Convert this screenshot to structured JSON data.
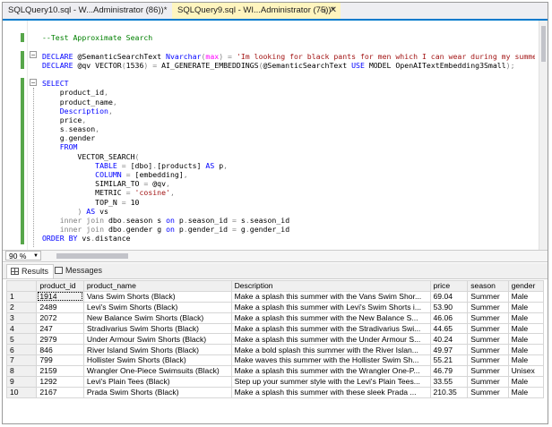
{
  "tabs": [
    {
      "title": "SQLQuery10.sql - W...Administrator (86))*",
      "active": false
    },
    {
      "title": "SQLQuery9.sql - WI...Administrator (75))*",
      "active": true,
      "pin": "⊣",
      "close": "✕"
    }
  ],
  "editor": {
    "zoom": "90 %",
    "lines": [
      [],
      [
        [
          "cm",
          "--Test Approximate Search"
        ]
      ],
      [],
      [
        [
          "kw",
          "DECLARE "
        ],
        [
          "id",
          "@SemanticSearchText "
        ],
        [
          "kw",
          "Nvarchar"
        ],
        [
          "gr",
          "("
        ],
        [
          "fn",
          "max"
        ],
        [
          "gr",
          ") = "
        ],
        [
          "str",
          "'Im looking for black pants for men which I can wear during my summer vacation.'"
        ]
      ],
      [
        [
          "kw",
          "DECLARE "
        ],
        [
          "id",
          "@qv "
        ],
        [
          "sq",
          "VECTOR"
        ],
        [
          "gr",
          "("
        ],
        [
          "id",
          "1536"
        ],
        [
          "gr",
          ") = "
        ],
        [
          "sq",
          "AI_GENERATE_EMBEDDINGS"
        ],
        [
          "gr",
          "("
        ],
        [
          "sq",
          "@SemanticSearchText"
        ],
        [
          "id",
          " "
        ],
        [
          "kw",
          "USE "
        ],
        [
          "id",
          "MODEL "
        ],
        [
          "sq",
          "OpenAITextEmbedding3Small"
        ],
        [
          "gr",
          ");"
        ]
      ],
      [],
      [
        [
          "kw",
          "SELECT"
        ]
      ],
      [
        [
          "id",
          "    product_id"
        ],
        [
          "gr",
          ","
        ]
      ],
      [
        [
          "id",
          "    product_name"
        ],
        [
          "gr",
          ","
        ]
      ],
      [
        [
          "id",
          "    "
        ],
        [
          "kw",
          "Description"
        ],
        [
          "gr",
          ","
        ]
      ],
      [
        [
          "id",
          "    price"
        ],
        [
          "gr",
          ","
        ]
      ],
      [
        [
          "id",
          "    s"
        ],
        [
          "gr",
          "."
        ],
        [
          "id",
          "season"
        ],
        [
          "gr",
          ","
        ]
      ],
      [
        [
          "id",
          "    g"
        ],
        [
          "gr",
          "."
        ],
        [
          "id",
          "gender"
        ]
      ],
      [
        [
          "id",
          "    "
        ],
        [
          "kw",
          "FROM"
        ]
      ],
      [
        [
          "id",
          "        VECTOR_SEARCH"
        ],
        [
          "gr",
          "("
        ]
      ],
      [
        [
          "id",
          "            "
        ],
        [
          "kw",
          "TABLE "
        ],
        [
          "gr",
          "= "
        ],
        [
          "id",
          "[dbo]"
        ],
        [
          "gr",
          "."
        ],
        [
          "id",
          "[products] "
        ],
        [
          "kw",
          "AS "
        ],
        [
          "id",
          "p"
        ],
        [
          "gr",
          ","
        ]
      ],
      [
        [
          "id",
          "            "
        ],
        [
          "kw",
          "COLUMN "
        ],
        [
          "gr",
          "= "
        ],
        [
          "id",
          "[embedding]"
        ],
        [
          "gr",
          ","
        ]
      ],
      [
        [
          "id",
          "            SIMILAR_TO "
        ],
        [
          "gr",
          "= "
        ],
        [
          "id",
          "@qv"
        ],
        [
          "gr",
          ","
        ]
      ],
      [
        [
          "id",
          "            METRIC "
        ],
        [
          "gr",
          "= "
        ],
        [
          "str",
          "'cosine'"
        ],
        [
          "gr",
          ","
        ]
      ],
      [
        [
          "id",
          "            TOP_N "
        ],
        [
          "gr",
          "= "
        ],
        [
          "id",
          "10"
        ]
      ],
      [
        [
          "id",
          "        "
        ],
        [
          "gr",
          ") "
        ],
        [
          "kw",
          "AS "
        ],
        [
          "id",
          "vs"
        ]
      ],
      [
        [
          "id",
          "    "
        ],
        [
          "gr",
          "inner join "
        ],
        [
          "id",
          "dbo"
        ],
        [
          "gr",
          "."
        ],
        [
          "id",
          "season s "
        ],
        [
          "kw",
          "on "
        ],
        [
          "id",
          "p"
        ],
        [
          "gr",
          "."
        ],
        [
          "id",
          "season_id "
        ],
        [
          "gr",
          "= "
        ],
        [
          "id",
          "s"
        ],
        [
          "gr",
          "."
        ],
        [
          "id",
          "season_id"
        ]
      ],
      [
        [
          "id",
          "    "
        ],
        [
          "gr",
          "inner join "
        ],
        [
          "id",
          "dbo"
        ],
        [
          "gr",
          "."
        ],
        [
          "id",
          "gender g "
        ],
        [
          "kw",
          "on "
        ],
        [
          "id",
          "p"
        ],
        [
          "gr",
          "."
        ],
        [
          "id",
          "gender_id "
        ],
        [
          "gr",
          "= "
        ],
        [
          "id",
          "g"
        ],
        [
          "gr",
          "."
        ],
        [
          "id",
          "gender_id"
        ]
      ],
      [
        [
          "kw",
          "ORDER BY "
        ],
        [
          "id",
          "vs"
        ],
        [
          "gr",
          "."
        ],
        [
          "id",
          "distance"
        ]
      ]
    ]
  },
  "results_tabs": {
    "results": "Results",
    "messages": "Messages"
  },
  "grid": {
    "columns": [
      "product_id",
      "product_name",
      "Description",
      "price",
      "season",
      "gender"
    ],
    "rows": [
      {
        "n": "1",
        "cells": [
          "1914",
          "Vans Swim Shorts (Black)",
          "Make a splash this summer with the Vans Swim Shor...",
          "69.04",
          "Summer",
          "Male"
        ]
      },
      {
        "n": "2",
        "cells": [
          "2489",
          "Levi's Swim Shorts (Black)",
          "Make a splash this summer with Levi's Swim Shorts i...",
          "53.90",
          "Summer",
          "Male"
        ]
      },
      {
        "n": "3",
        "cells": [
          "2072",
          "New Balance Swim Shorts (Black)",
          "Make a splash this summer with the New Balance S...",
          "46.06",
          "Summer",
          "Male"
        ]
      },
      {
        "n": "4",
        "cells": [
          "247",
          "Stradivarius Swim Shorts (Black)",
          "Make a splash this summer with the Stradivarius Swi...",
          "44.65",
          "Summer",
          "Male"
        ]
      },
      {
        "n": "5",
        "cells": [
          "2979",
          "Under Armour Swim Shorts (Black)",
          "Make a splash this summer with the Under Armour S...",
          "40.24",
          "Summer",
          "Male"
        ]
      },
      {
        "n": "6",
        "cells": [
          "846",
          "River Island Swim Shorts (Black)",
          "Make a bold splash this summer with the River Islan...",
          "49.97",
          "Summer",
          "Male"
        ]
      },
      {
        "n": "7",
        "cells": [
          "799",
          "Hollister Swim Shorts (Black)",
          "Make waves this summer with the Hollister Swim Sh...",
          "55.21",
          "Summer",
          "Male"
        ]
      },
      {
        "n": "8",
        "cells": [
          "2159",
          "Wrangler One-Piece Swimsuits (Black)",
          "Make a splash this summer with the Wrangler One-P...",
          "46.79",
          "Summer",
          "Unisex"
        ]
      },
      {
        "n": "9",
        "cells": [
          "1292",
          "Levi's Plain Tees (Black)",
          "Step up your summer style with the Levi's Plain Tees...",
          "33.55",
          "Summer",
          "Male"
        ]
      },
      {
        "n": "10",
        "cells": [
          "2167",
          "Prada Swim Shorts (Black)",
          "Make a splash this summer with these sleek Prada ...",
          "210.35",
          "Summer",
          "Male"
        ]
      }
    ]
  },
  "colors": {
    "accent": "#007acc",
    "active_tab": "#fff5bf",
    "keyword": "#0000ff",
    "string": "#a31515",
    "comment": "#008000",
    "function": "#ff00ff"
  }
}
